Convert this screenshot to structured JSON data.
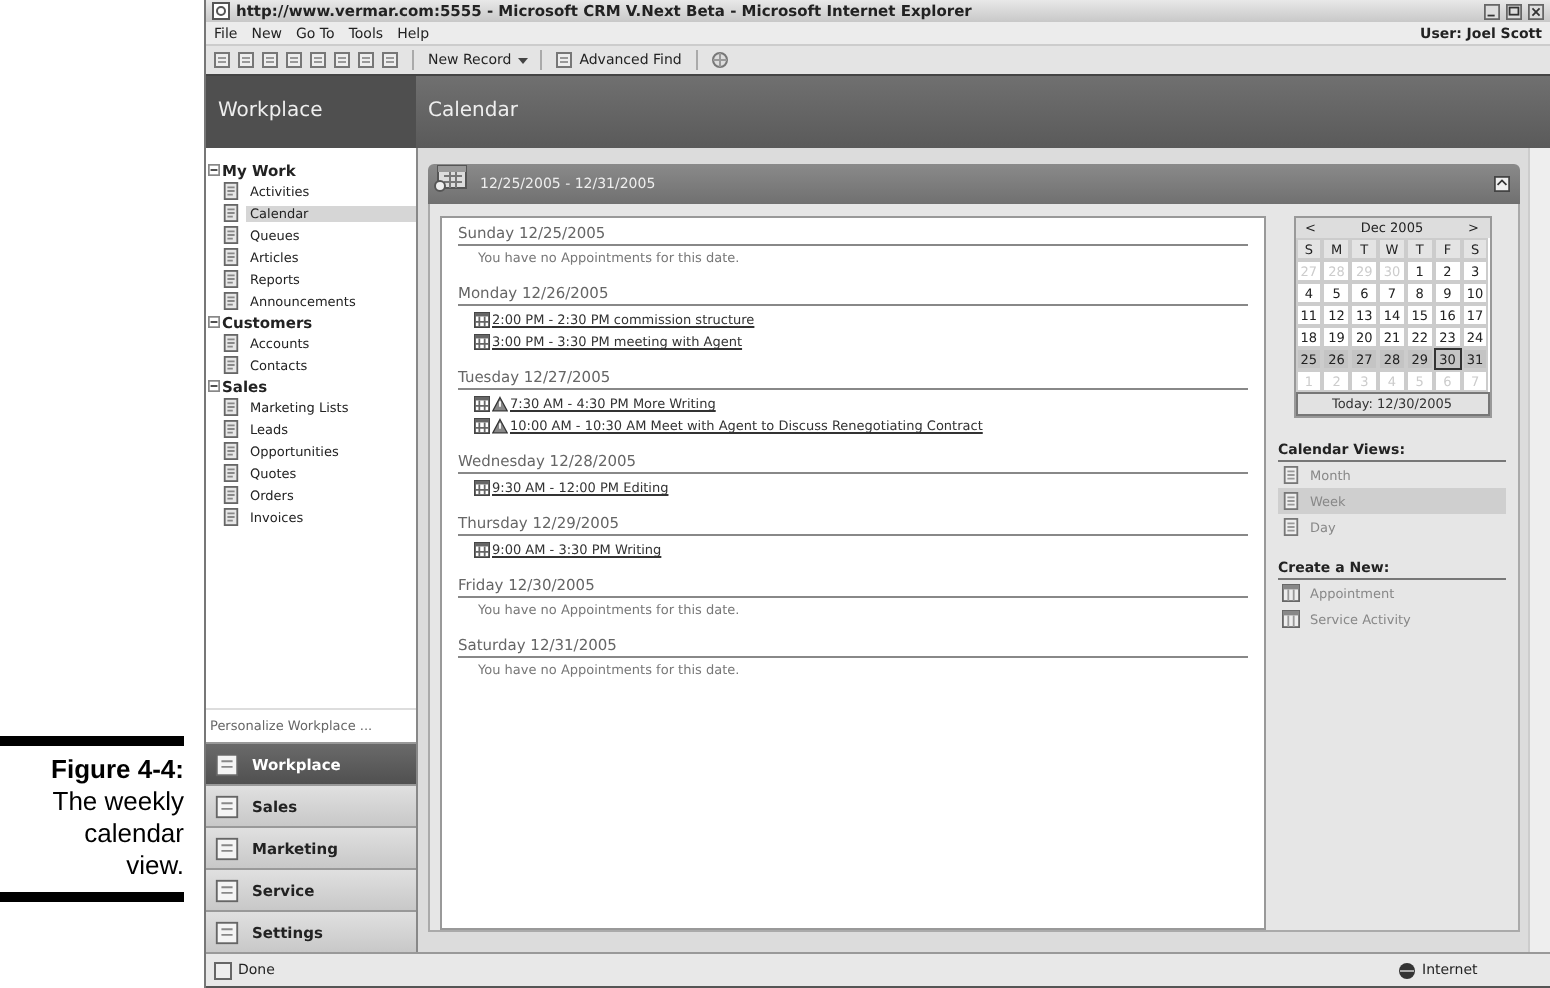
{
  "caption": {
    "label": "Figure 4-4:",
    "text": "The weekly calendar view."
  },
  "window": {
    "title": "http://www.vermar.com:5555 - Microsoft CRM V.Next Beta - Microsoft Internet Explorer"
  },
  "menu": [
    "File",
    "New",
    "Go To",
    "Tools",
    "Help"
  ],
  "user": "User: Joel Scott",
  "toolbar": {
    "new_record": "New Record",
    "advanced_find": "Advanced Find"
  },
  "header": {
    "workplace": "Workplace",
    "page": "Calendar"
  },
  "sidebar": {
    "groups": [
      {
        "label": "My Work",
        "expanded": true,
        "items": [
          {
            "label": "Activities",
            "selected": false
          },
          {
            "label": "Calendar",
            "selected": true
          },
          {
            "label": "Queues",
            "selected": false
          },
          {
            "label": "Articles",
            "selected": false
          },
          {
            "label": "Reports",
            "selected": false
          },
          {
            "label": "Announcements",
            "selected": false
          }
        ]
      },
      {
        "label": "Customers",
        "expanded": true,
        "items": [
          {
            "label": "Accounts",
            "selected": false
          },
          {
            "label": "Contacts",
            "selected": false
          }
        ]
      },
      {
        "label": "Sales",
        "expanded": true,
        "items": [
          {
            "label": "Marketing Lists",
            "selected": false
          },
          {
            "label": "Leads",
            "selected": false
          },
          {
            "label": "Opportunities",
            "selected": false
          },
          {
            "label": "Quotes",
            "selected": false
          },
          {
            "label": "Orders",
            "selected": false
          },
          {
            "label": "Invoices",
            "selected": false
          }
        ]
      }
    ],
    "personalize": "Personalize Workplace ..."
  },
  "modules": [
    {
      "label": "Workplace",
      "selected": true
    },
    {
      "label": "Sales",
      "selected": false
    },
    {
      "label": "Marketing",
      "selected": false
    },
    {
      "label": "Service",
      "selected": false
    },
    {
      "label": "Settings",
      "selected": false
    }
  ],
  "range": "12/25/2005 - 12/31/2005",
  "days": [
    {
      "heading": "Sunday 12/25/2005",
      "empty_text": "You have no Appointments for this date."
    },
    {
      "heading": "Monday 12/26/2005",
      "appointments": [
        {
          "text": "2:00 PM - 2:30 PM commission structure",
          "warning": false
        },
        {
          "text": "3:00 PM - 3:30 PM meeting with Agent",
          "warning": false
        }
      ]
    },
    {
      "heading": "Tuesday 12/27/2005",
      "appointments": [
        {
          "text": "7:30 AM - 4:30 PM More Writing",
          "warning": true
        },
        {
          "text": "10:00 AM - 10:30 AM Meet with Agent to Discuss Renegotiating Contract",
          "warning": true
        }
      ]
    },
    {
      "heading": "Wednesday 12/28/2005",
      "appointments": [
        {
          "text": "9:30 AM - 12:00 PM Editing",
          "warning": false
        }
      ]
    },
    {
      "heading": "Thursday 12/29/2005",
      "appointments": [
        {
          "text": "9:00 AM - 3:30 PM Writing",
          "warning": false
        }
      ]
    },
    {
      "heading": "Friday 12/30/2005",
      "empty_text": "You have no Appointments for this date."
    },
    {
      "heading": "Saturday 12/31/2005",
      "empty_text": "You have no Appointments for this date."
    }
  ],
  "mini_calendar": {
    "prev": "<",
    "month": "Dec 2005",
    "next": ">",
    "weekdays": [
      "S",
      "M",
      "T",
      "W",
      "T",
      "F",
      "S"
    ],
    "weeks": [
      {
        "selected": false,
        "days": [
          {
            "label": "27",
            "other_month": true,
            "today": false
          },
          {
            "label": "28",
            "other_month": true,
            "today": false
          },
          {
            "label": "29",
            "other_month": true,
            "today": false
          },
          {
            "label": "30",
            "other_month": true,
            "today": false
          },
          {
            "label": "1",
            "other_month": false,
            "today": false
          },
          {
            "label": "2",
            "other_month": false,
            "today": false
          },
          {
            "label": "3",
            "other_month": false,
            "today": false
          }
        ]
      },
      {
        "selected": false,
        "days": [
          {
            "label": "4",
            "other_month": false,
            "today": false
          },
          {
            "label": "5",
            "other_month": false,
            "today": false
          },
          {
            "label": "6",
            "other_month": false,
            "today": false
          },
          {
            "label": "7",
            "other_month": false,
            "today": false
          },
          {
            "label": "8",
            "other_month": false,
            "today": false
          },
          {
            "label": "9",
            "other_month": false,
            "today": false
          },
          {
            "label": "10",
            "other_month": false,
            "today": false
          }
        ]
      },
      {
        "selected": false,
        "days": [
          {
            "label": "11",
            "other_month": false,
            "today": false
          },
          {
            "label": "12",
            "other_month": false,
            "today": false
          },
          {
            "label": "13",
            "other_month": false,
            "today": false
          },
          {
            "label": "14",
            "other_month": false,
            "today": false
          },
          {
            "label": "15",
            "other_month": false,
            "today": false
          },
          {
            "label": "16",
            "other_month": false,
            "today": false
          },
          {
            "label": "17",
            "other_month": false,
            "today": false
          }
        ]
      },
      {
        "selected": false,
        "days": [
          {
            "label": "18",
            "other_month": false,
            "today": false
          },
          {
            "label": "19",
            "other_month": false,
            "today": false
          },
          {
            "label": "20",
            "other_month": false,
            "today": false
          },
          {
            "label": "21",
            "other_month": false,
            "today": false
          },
          {
            "label": "22",
            "other_month": false,
            "today": false
          },
          {
            "label": "23",
            "other_month": false,
            "today": false
          },
          {
            "label": "24",
            "other_month": false,
            "today": false
          }
        ]
      },
      {
        "selected": true,
        "days": [
          {
            "label": "25",
            "other_month": false,
            "today": false
          },
          {
            "label": "26",
            "other_month": false,
            "today": false
          },
          {
            "label": "27",
            "other_month": false,
            "today": false
          },
          {
            "label": "28",
            "other_month": false,
            "today": false
          },
          {
            "label": "29",
            "other_month": false,
            "today": false
          },
          {
            "label": "30",
            "other_month": false,
            "today": true
          },
          {
            "label": "31",
            "other_month": false,
            "today": false
          }
        ]
      },
      {
        "selected": false,
        "days": [
          {
            "label": "1",
            "other_month": true,
            "today": false
          },
          {
            "label": "2",
            "other_month": true,
            "today": false
          },
          {
            "label": "3",
            "other_month": true,
            "today": false
          },
          {
            "label": "4",
            "other_month": true,
            "today": false
          },
          {
            "label": "5",
            "other_month": true,
            "today": false
          },
          {
            "label": "6",
            "other_month": true,
            "today": false
          },
          {
            "label": "7",
            "other_month": true,
            "today": false
          }
        ]
      }
    ],
    "today_button": "Today: 12/30/2005"
  },
  "views": {
    "title": "Calendar Views:",
    "items": [
      {
        "label": "Month",
        "selected": false
      },
      {
        "label": "Week",
        "selected": true
      },
      {
        "label": "Day",
        "selected": false
      }
    ]
  },
  "create": {
    "title": "Create a New:",
    "items": [
      "Appointment",
      "Service Activity"
    ]
  },
  "status": {
    "text": "Done",
    "zone": "Internet"
  }
}
